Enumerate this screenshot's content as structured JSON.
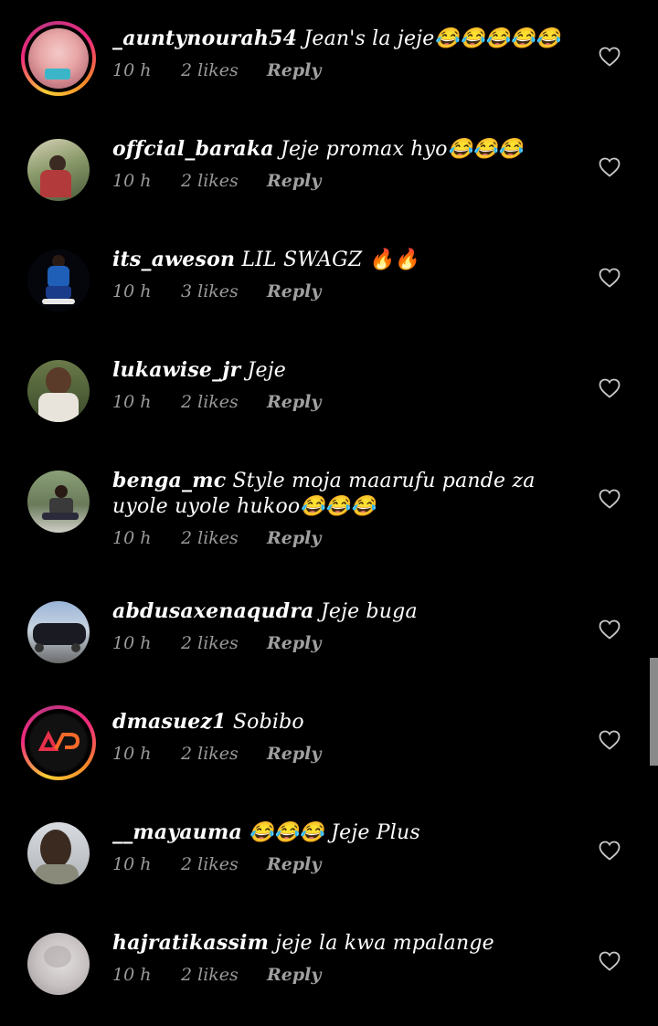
{
  "comments": [
    {
      "username": "_auntynourah54",
      "text": "Jean's la jeje😂😂😂😂😂",
      "time": "10 h",
      "likes": "2 likes",
      "reply": "Reply",
      "avatar": "avatar-pink"
    },
    {
      "username": "offcial_baraka",
      "text": "Jeje promax hyo😂😂😂",
      "time": "10 h",
      "likes": "2 likes",
      "reply": "Reply",
      "avatar": "avatar-outdoor"
    },
    {
      "username": "its_aweson",
      "text": "LIL SWAGZ 🔥🔥",
      "time": "10 h",
      "likes": "3 likes",
      "reply": "Reply",
      "avatar": "avatar-dark-blue"
    },
    {
      "username": "lukawise_jr",
      "text": "Jeje",
      "time": "10 h",
      "likes": "2 likes",
      "reply": "Reply",
      "avatar": "avatar-portrait"
    },
    {
      "username": "benga_mc",
      "text": "Style moja maarufu pande za uyole uyole hukoo😂😂😂",
      "time": "10 h",
      "likes": "2 likes",
      "reply": "Reply",
      "avatar": "avatar-sitting"
    },
    {
      "username": "abdusaxenaqudra",
      "text": "Jeje buga",
      "time": "10 h",
      "likes": "2 likes",
      "reply": "Reply",
      "avatar": "avatar-truck"
    },
    {
      "username": "dmasuez1",
      "text": "Sobibo",
      "time": "10 h",
      "likes": "2 likes",
      "reply": "Reply",
      "avatar": "avatar-logo"
    },
    {
      "username": "__mayauma",
      "text": "😂😂😂 Jeje Plus",
      "time": "10 h",
      "likes": "2 likes",
      "reply": "Reply",
      "avatar": "avatar-selfie"
    },
    {
      "username": "hajratikassim",
      "text": "jeje la kwa mpalange",
      "time": "10 h",
      "likes": "2 likes",
      "reply": "Reply",
      "avatar": "avatar-blurred"
    }
  ],
  "icons": {
    "like": "heart-outline-icon"
  },
  "colors": {
    "background": "#000000",
    "meta_text": "#9a9a9a",
    "story_ring": "#ee2a7b"
  }
}
